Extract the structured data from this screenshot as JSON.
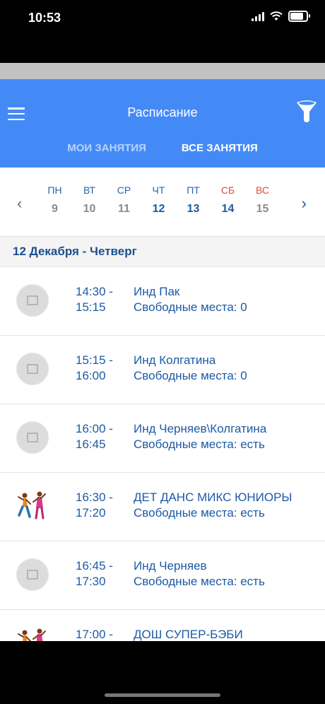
{
  "status_bar": {
    "time": "10:53",
    "battery_level": 0.9
  },
  "header": {
    "title": "Расписание",
    "tabs": [
      {
        "label": "МОИ ЗАНЯТИЯ",
        "active": false
      },
      {
        "label": "ВСЕ ЗАНЯТИЯ",
        "active": true
      }
    ]
  },
  "week": {
    "days": [
      {
        "name": "ПН",
        "num": "9",
        "weekend": false,
        "active": false
      },
      {
        "name": "ВТ",
        "num": "10",
        "weekend": false,
        "active": false
      },
      {
        "name": "СР",
        "num": "11",
        "weekend": false,
        "active": false
      },
      {
        "name": "ЧТ",
        "num": "12",
        "weekend": false,
        "active": true
      },
      {
        "name": "ПТ",
        "num": "13",
        "weekend": false,
        "active": true
      },
      {
        "name": "СБ",
        "num": "14",
        "weekend": true,
        "active": true
      },
      {
        "name": "ВС",
        "num": "15",
        "weekend": true,
        "active": false
      }
    ]
  },
  "date_header": "12 Декабря - Четверг",
  "classes": [
    {
      "start": "14:30 -",
      "end": "15:15",
      "name": "Инд Пак",
      "seats": "Свободные места: 0",
      "image": "placeholder"
    },
    {
      "start": "15:15 -",
      "end": "16:00",
      "name": "Инд Колгатина",
      "seats": "Свободные места: 0",
      "image": "placeholder"
    },
    {
      "start": "16:00 -",
      "end": "16:45",
      "name": "Инд Черняев\\Колгатина",
      "seats": "Свободные места: есть",
      "image": "placeholder"
    },
    {
      "start": "16:30 -",
      "end": "17:20",
      "name": "ДЕТ ДАНС МИКС ЮНИОРЫ",
      "seats": "Свободные места: есть",
      "image": "dancers"
    },
    {
      "start": "16:45 -",
      "end": "17:30",
      "name": "Инд Черняев",
      "seats": "Свободные места: есть",
      "image": "placeholder"
    },
    {
      "start": "17:00 -",
      "end": "",
      "name": "ДОШ СУПЕР-БЭБИ",
      "seats": "",
      "image": "dancers"
    }
  ],
  "colors": {
    "header_bg": "#448af7",
    "accent_text": "#1c5aa6",
    "weekend": "#e24a3c"
  }
}
